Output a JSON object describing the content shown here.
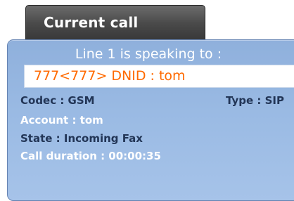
{
  "tab": {
    "label": "Current call"
  },
  "panel": {
    "speaking_label": "Line 1 is speaking to :",
    "caller_id": "777<777> DNID : tom",
    "codec": "Codec : GSM",
    "type": "Type : SIP",
    "account": "Account : tom",
    "state": "State : Incoming Fax",
    "duration": "Call duration : 00:00:35"
  },
  "colors": {
    "tab_bg": "#4a4a4a",
    "panel_bg": "#9bbbe4",
    "caller_text": "#ff6a00",
    "dark_text": "#223556",
    "light_text": "#ffffff"
  }
}
